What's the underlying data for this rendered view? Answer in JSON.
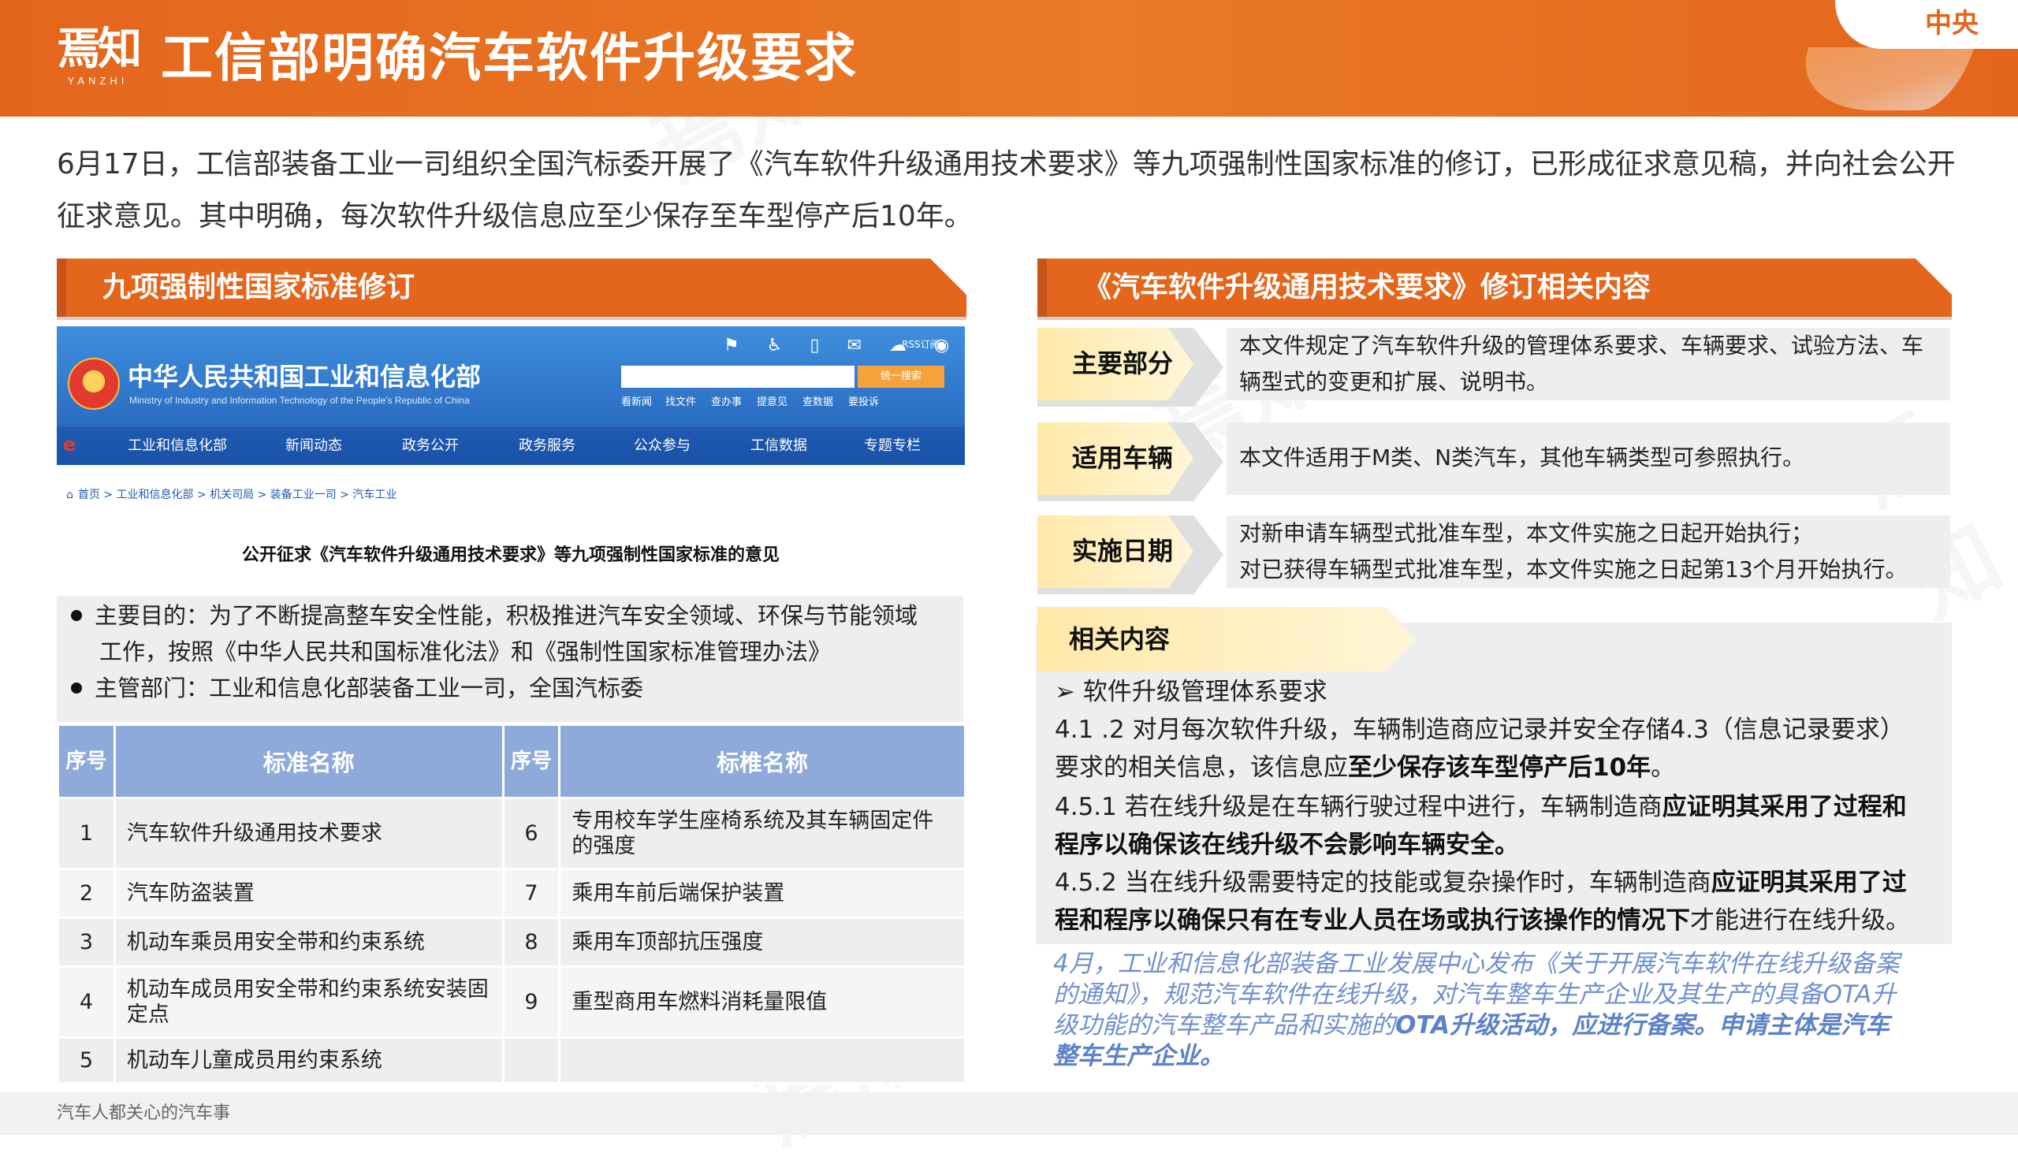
{
  "header": {
    "logo_cn": "焉知",
    "logo_en": "YANZHI",
    "title": "工信部明确汽车软件升级要求",
    "tag": "中央"
  },
  "intro": "6月17日，工信部装备工业一司组织全国汽标委开展了《汽车软件升级通用技术要求》等九项强制性国家标准的修订，已形成征求意见稿，并向社会公开征求意见。其中明确，每次软件升级信息应至少保存至车型停产后10年。",
  "left": {
    "section_title": "九项强制性国家标准修订",
    "site": {
      "cn_name": "中华人民共和国工业和信息化部",
      "en_name": "Ministry of Industry and Information Technology of the People's Republic of China",
      "icons": "⚑ ♿ ▯ ✉ ☁ ◉",
      "rss": "RSS订阅",
      "search_button": "统一搜索",
      "quick_links": [
        "看新闻",
        "找文件",
        "查办事",
        "提意见",
        "查数据",
        "要投诉"
      ],
      "nav": [
        "工业和信息化部",
        "新闻动态",
        "政务公开",
        "政务服务",
        "公众参与",
        "工信数据",
        "专题专栏"
      ]
    },
    "breadcrumb": "首页 > 工业和信息化部 > 机关司局 > 装备工业一司 > 汽车工业",
    "notice_title": "公开征求《汽车软件升级通用技术要求》等九项强制性国家标准的意见",
    "bullets": [
      "主要目的：为了不断提高整车安全性能，积极推进汽车安全领域、环保与节能领域",
      "工作，按照《中华人民共和国标准化法》和《强制性国家标准管理办法》",
      "主管部门：工业和信息化部装备工业一司，全国汽标委"
    ],
    "table": {
      "headers": [
        "序号",
        "标准名称",
        "序号",
        "标椎名称"
      ],
      "rows": [
        [
          "1",
          "汽车软件升级通用技术要求",
          "6",
          "专用校车学生座椅系统及其车辆固定件的强度"
        ],
        [
          "2",
          "汽车防盗装置",
          "7",
          "乘用车前后端保护装置"
        ],
        [
          "3",
          "机动车乘员用安全带和约束系统",
          "8",
          "乘用车顶部抗压强度"
        ],
        [
          "4",
          "机动车成员用安全带和约束系统安装固定点",
          "9",
          "重型商用车燃料消耗量限值"
        ],
        [
          "5",
          "机动车儿童成员用约束系统",
          "",
          ""
        ]
      ]
    }
  },
  "right": {
    "section_title": "《汽车软件升级通用技术要求》修订相关内容",
    "items": [
      {
        "label": "主要部分",
        "value": "本文件规定了汽车软件升级的管理体系要求、车辆要求、试验方法、车辆型式的变更和扩展、说明书。"
      },
      {
        "label": "适用车辆",
        "value": "本文件适用于M类、N类汽车，其他车辆类型可参照执行。"
      },
      {
        "label": "实施日期",
        "value_lines": [
          "对新申请车辆型式批准车型，本文件实施之日起开始执行；",
          "对已获得车辆型式批准车型，本文件实施之日起第13个月开始执行。"
        ]
      }
    ],
    "related": {
      "label": "相关内容",
      "heading": "➢ 软件升级管理体系要求",
      "p1_a": "4.1 .2  对月每次软件升级，车辆制造商应记录并安全存储4.3（信息记录要求）",
      "p1_b": "要求的相关信息，该信息应",
      "p1_bold": "至少保存该车型停产后10年",
      "p1_end": "。",
      "p2_a": "4.5.1  若在线升级是在车辆行驶过程中进行，车辆制造商",
      "p2_bold1": "应证明其采用了过程和",
      "p2_bold2": "程序以确保该在线升级不会影响车辆安全。",
      "p3_a": "4.5.2  当在线升级需要特定的技能或复杂操作时，车辆制造商",
      "p3_bold1": "应证明其采用了过",
      "p3_bold2": "程和程序以确保只有在专业人员在场或执行该操作的情况下",
      "p3_end": "才能进行在线升级。"
    },
    "note": {
      "line1": "4月，工业和信息化部装备工业发展中心发布《关于开展汽车软件在线升级备案",
      "line2": "的通知》，规范汽车软件在线升级，对汽车整车生产企业及其生产的具备OTA升",
      "line3a": "级功能的汽车整车产品和实施的",
      "line3b": "OTA升级活动，应进行备案。申请主体是汽车",
      "line4": "整车生产企业。"
    }
  },
  "footer": "汽车人都关心的汽车事",
  "watermark": "焉知",
  "colors": {
    "accent": "#e4661c",
    "table_header": "#8eaadb",
    "label_fill": "#ffe9a8",
    "note_text": "#6f8fcf"
  }
}
